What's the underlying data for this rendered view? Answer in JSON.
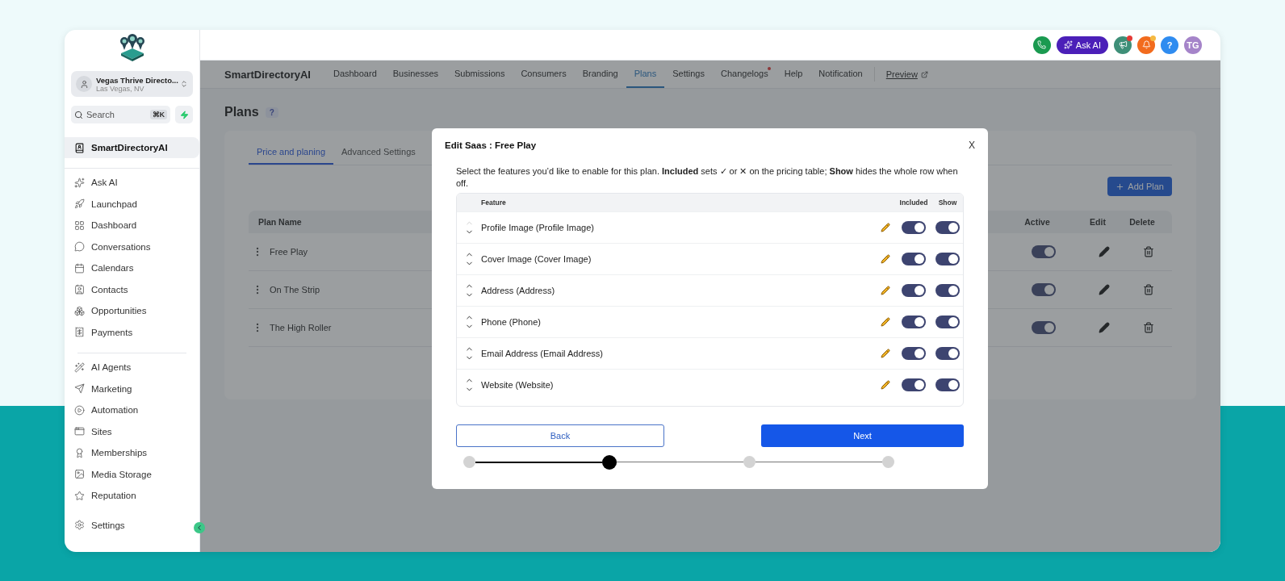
{
  "sidebar": {
    "account": {
      "name": "Vegas Thrive Directo...",
      "location": "Las Vegas, NV"
    },
    "search": {
      "placeholder": "Search",
      "shortcut": "⌘K"
    },
    "app_item": {
      "label": "SmartDirectoryAI",
      "selected": true
    },
    "groups": [
      [
        {
          "label": "Ask AI"
        },
        {
          "label": "Launchpad"
        },
        {
          "label": "Dashboard"
        },
        {
          "label": "Conversations"
        },
        {
          "label": "Calendars"
        },
        {
          "label": "Contacts"
        },
        {
          "label": "Opportunities"
        },
        {
          "label": "Payments"
        }
      ],
      [
        {
          "label": "AI Agents"
        },
        {
          "label": "Marketing"
        },
        {
          "label": "Automation"
        },
        {
          "label": "Sites"
        },
        {
          "label": "Memberships"
        },
        {
          "label": "Media Storage"
        },
        {
          "label": "Reputation"
        }
      ]
    ],
    "settings": "Settings"
  },
  "header": {
    "ask_ai": "Ask AI",
    "announcements": {
      "notification": true
    },
    "alerts": {
      "notification": true
    },
    "help": "?",
    "avatar": "TG"
  },
  "nav": {
    "brand": "SmartDirectoryAI",
    "tabs": [
      {
        "label": "Dashboard",
        "selected": false,
        "notification": false
      },
      {
        "label": "Businesses",
        "selected": false,
        "notification": false
      },
      {
        "label": "Submissions",
        "selected": false,
        "notification": false
      },
      {
        "label": "Consumers",
        "selected": false,
        "notification": false
      },
      {
        "label": "Branding",
        "selected": false,
        "notification": false
      },
      {
        "label": "Plans",
        "selected": true,
        "notification": false
      },
      {
        "label": "Settings",
        "selected": false,
        "notification": false
      },
      {
        "label": "Changelogs",
        "selected": false,
        "notification": true
      },
      {
        "label": "Help",
        "selected": false,
        "notification": false
      },
      {
        "label": "Notification",
        "selected": false,
        "notification": false
      }
    ],
    "preview": "Preview"
  },
  "page": {
    "title": "Plans",
    "help": "?",
    "tabs": [
      {
        "label": "Price and planing",
        "selected": true
      },
      {
        "label": "Advanced Settings",
        "selected": false
      }
    ],
    "add_button": "Add Plan",
    "columns": {
      "name": "Plan Name",
      "active": "Active",
      "edit": "Edit",
      "delete": "Delete"
    },
    "plans": [
      {
        "name": "Free Play",
        "active": true
      },
      {
        "name": "On The Strip",
        "active": true
      },
      {
        "name": "The High Roller",
        "active": true
      }
    ]
  },
  "modal": {
    "title": "Edit Saas : Free Play",
    "close": "X",
    "description": "Select the features you’d like to enable for this plan. **Included** sets ✓ or ✕ on the pricing table; **Show** hides the whole row when off.",
    "columns": {
      "feature": "Feature",
      "included": "Included",
      "show": "Show"
    },
    "features": [
      {
        "name": "Profile Image (Profile Image)",
        "up_disabled": true,
        "included": true,
        "show": true
      },
      {
        "name": "Cover Image (Cover Image)",
        "up_disabled": false,
        "included": true,
        "show": true
      },
      {
        "name": "Address (Address)",
        "up_disabled": false,
        "included": true,
        "show": true
      },
      {
        "name": "Phone (Phone)",
        "up_disabled": false,
        "included": true,
        "show": true
      },
      {
        "name": "Email Address (Email Address)",
        "up_disabled": false,
        "included": true,
        "show": true
      },
      {
        "name": "Website (Website)",
        "up_disabled": false,
        "included": true,
        "show": true
      }
    ],
    "back": "Back",
    "next": "Next",
    "steps": [
      {
        "selected": false
      },
      {
        "selected": true
      },
      {
        "selected": false
      },
      {
        "selected": false
      }
    ],
    "connectors": [
      {
        "done": true
      },
      {
        "done": false
      },
      {
        "done": false
      }
    ]
  }
}
